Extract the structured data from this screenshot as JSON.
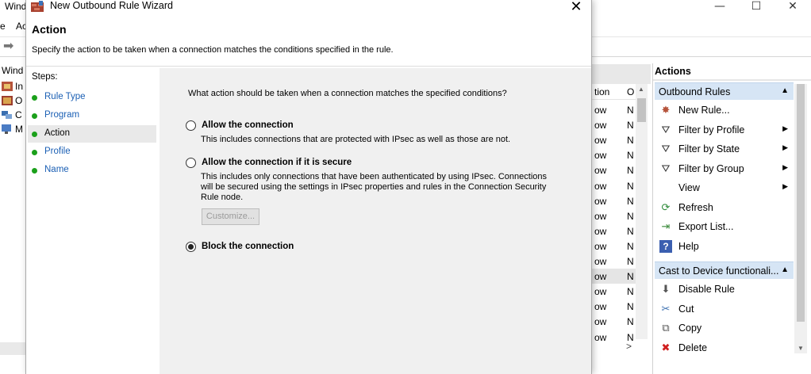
{
  "background": {
    "window_title": "Wind",
    "menu": [
      "e",
      "Ac"
    ],
    "tree": [
      "Wind",
      "In",
      "O",
      "C",
      "M"
    ],
    "list_headers": [
      "tion",
      "O"
    ],
    "list_rows": [
      [
        "ow",
        "N"
      ],
      [
        "ow",
        "N"
      ],
      [
        "ow",
        "N"
      ],
      [
        "ow",
        "N"
      ],
      [
        "ow",
        "N"
      ],
      [
        "ow",
        "N"
      ],
      [
        "ow",
        "N"
      ],
      [
        "ow",
        "N"
      ],
      [
        "ow",
        "N"
      ],
      [
        "ow",
        "N"
      ],
      [
        "ow",
        "N"
      ],
      [
        "ow",
        "N"
      ],
      [
        "ow",
        "N"
      ],
      [
        "ow",
        "N"
      ],
      [
        "ow",
        "N"
      ],
      [
        "ow",
        "N"
      ]
    ],
    "list_selected_row": 11,
    "list_bottom_arrow": ">",
    "caption_buttons": [
      "—",
      "☐",
      "✕"
    ]
  },
  "actions": {
    "title": "Actions",
    "group1": "Outbound Rules",
    "group1_items": [
      {
        "label": "New Rule...",
        "icon": "new-rule-icon",
        "glyph": "✸",
        "submenu": false
      },
      {
        "label": "Filter by Profile",
        "icon": "filter-icon",
        "glyph": "⛛",
        "submenu": true
      },
      {
        "label": "Filter by State",
        "icon": "filter-icon",
        "glyph": "⛛",
        "submenu": true
      },
      {
        "label": "Filter by Group",
        "icon": "filter-icon",
        "glyph": "⛛",
        "submenu": true
      },
      {
        "label": "View",
        "icon": "",
        "glyph": "",
        "submenu": true
      },
      {
        "label": "Refresh",
        "icon": "refresh-icon",
        "glyph": "⟳",
        "submenu": false
      },
      {
        "label": "Export List...",
        "icon": "export-icon",
        "glyph": "⇥",
        "submenu": false
      },
      {
        "label": "Help",
        "icon": "help-icon",
        "glyph": "?",
        "submenu": false
      }
    ],
    "group2": "Cast to Device functionali...",
    "group2_items": [
      {
        "label": "Disable Rule",
        "icon": "disable-icon",
        "glyph": "⬇"
      },
      {
        "label": "Cut",
        "icon": "cut-icon",
        "glyph": "✂"
      },
      {
        "label": "Copy",
        "icon": "copy-icon",
        "glyph": "⧉"
      },
      {
        "label": "Delete",
        "icon": "delete-icon",
        "glyph": "✖"
      }
    ],
    "submenu_glyph": "▶",
    "collapse_glyph": "▲"
  },
  "wizard": {
    "title": "New Outbound Rule Wizard",
    "close_glyph": "✕",
    "heading": "Action",
    "description": "Specify the action to be taken when a connection matches the conditions specified in the rule.",
    "steps_label": "Steps:",
    "steps": [
      "Rule Type",
      "Program",
      "Action",
      "Profile",
      "Name"
    ],
    "current_step": 2,
    "question": "What action should be taken when a connection matches the specified conditions?",
    "options": [
      {
        "label": "Allow the connection",
        "desc": "This includes connections that are protected with IPsec as well as those are not.",
        "selected": false
      },
      {
        "label": "Allow the connection if it is secure",
        "desc": "This includes only connections that have been authenticated by using IPsec.  Connections will be secured using the settings in IPsec properties and rules in the Connection Security Rule node.",
        "selected": false
      },
      {
        "label": "Block the connection",
        "desc": "",
        "selected": true
      }
    ],
    "customize_label": "Customize..."
  }
}
